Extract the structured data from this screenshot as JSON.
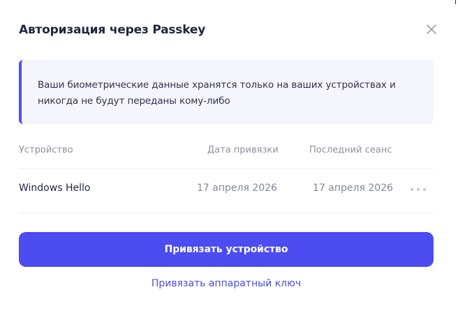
{
  "dialog": {
    "title": "Авторизация через Passkey",
    "close_icon": "close-icon"
  },
  "notice": {
    "text": "Ваши биометрические данные хранятся только на ваших устройствах и никогда не будут переданы кому-либо",
    "accent_color": "#4f4ff2"
  },
  "table": {
    "headers": [
      "Устройство",
      "Дата привязки",
      "Последний сеанс"
    ],
    "rows": [
      {
        "device": "Windows Hello",
        "linked_date": "17 апреля 2026",
        "last_session": "17 апреля 2026",
        "menu_icon": "more-horizontal-icon"
      }
    ]
  },
  "actions": {
    "primary_label": "Привязать устройство",
    "secondary_label": "Привязать аппаратный ключ",
    "primary_color": "#4c4cf0"
  }
}
